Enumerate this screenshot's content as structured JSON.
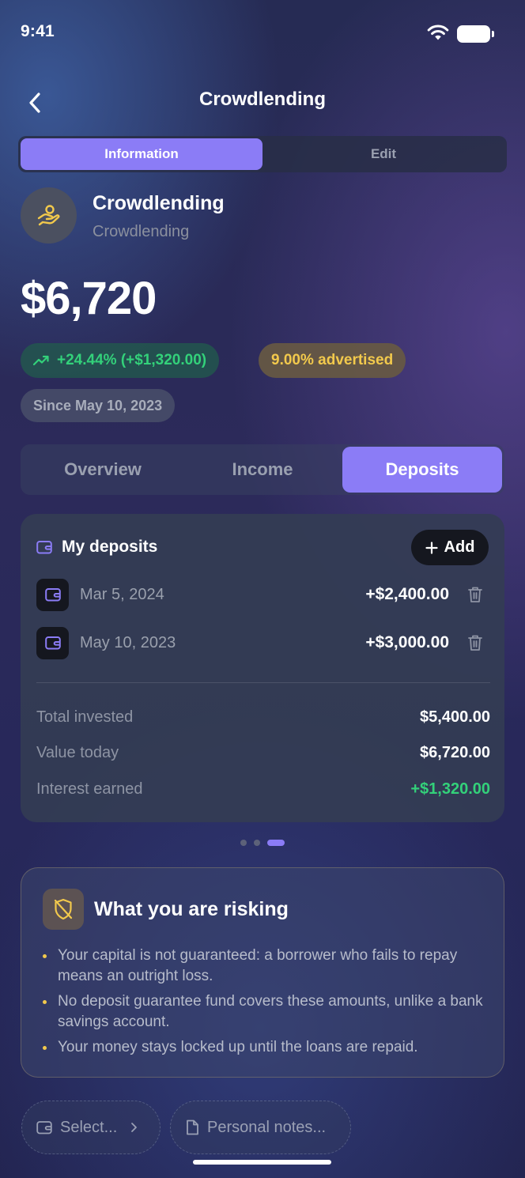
{
  "status_bar": {
    "time": "9:41"
  },
  "nav": {
    "title": "Crowdlending"
  },
  "top_segment": {
    "items": [
      "Information",
      "Edit"
    ],
    "active": "Information"
  },
  "asset": {
    "name": "Crowdlending",
    "category": "Crowdlending",
    "value": "$6,720",
    "gain": "+24.44% (+$1,320.00)",
    "advertised": "9.00% advertised",
    "since": "Since May 10, 2023"
  },
  "tabs": {
    "items": [
      "Overview",
      "Income",
      "Deposits"
    ],
    "active": "Deposits"
  },
  "deposits": {
    "title": "My deposits",
    "add_label": "Add",
    "rows": [
      {
        "date": "Mar 5, 2024",
        "amount": "+$2,400.00"
      },
      {
        "date": "May 10, 2023",
        "amount": "+$3,000.00"
      }
    ],
    "summary": [
      {
        "label": "Total invested",
        "value": "$5,400.00"
      },
      {
        "label": "Value today",
        "value": "$6,720.00"
      },
      {
        "label": "Interest earned",
        "value": "+$1,320.00"
      }
    ]
  },
  "pager": {
    "count": 3,
    "active_index": 2
  },
  "risk": {
    "title": "What you are risking",
    "items": [
      "Your capital is not guaranteed: a borrower who fails to repay means an outright loss.",
      "No deposit guarantee fund covers these amounts, unlike a bank savings account.",
      "Your money stays locked up until the loans are repaid."
    ]
  },
  "bottom_actions": {
    "select_label": "Select...",
    "notes_label": "Personal notes..."
  },
  "colors": {
    "accent": "#8b7cf6",
    "gain": "#33d17a",
    "warning": "#f2c94c"
  }
}
